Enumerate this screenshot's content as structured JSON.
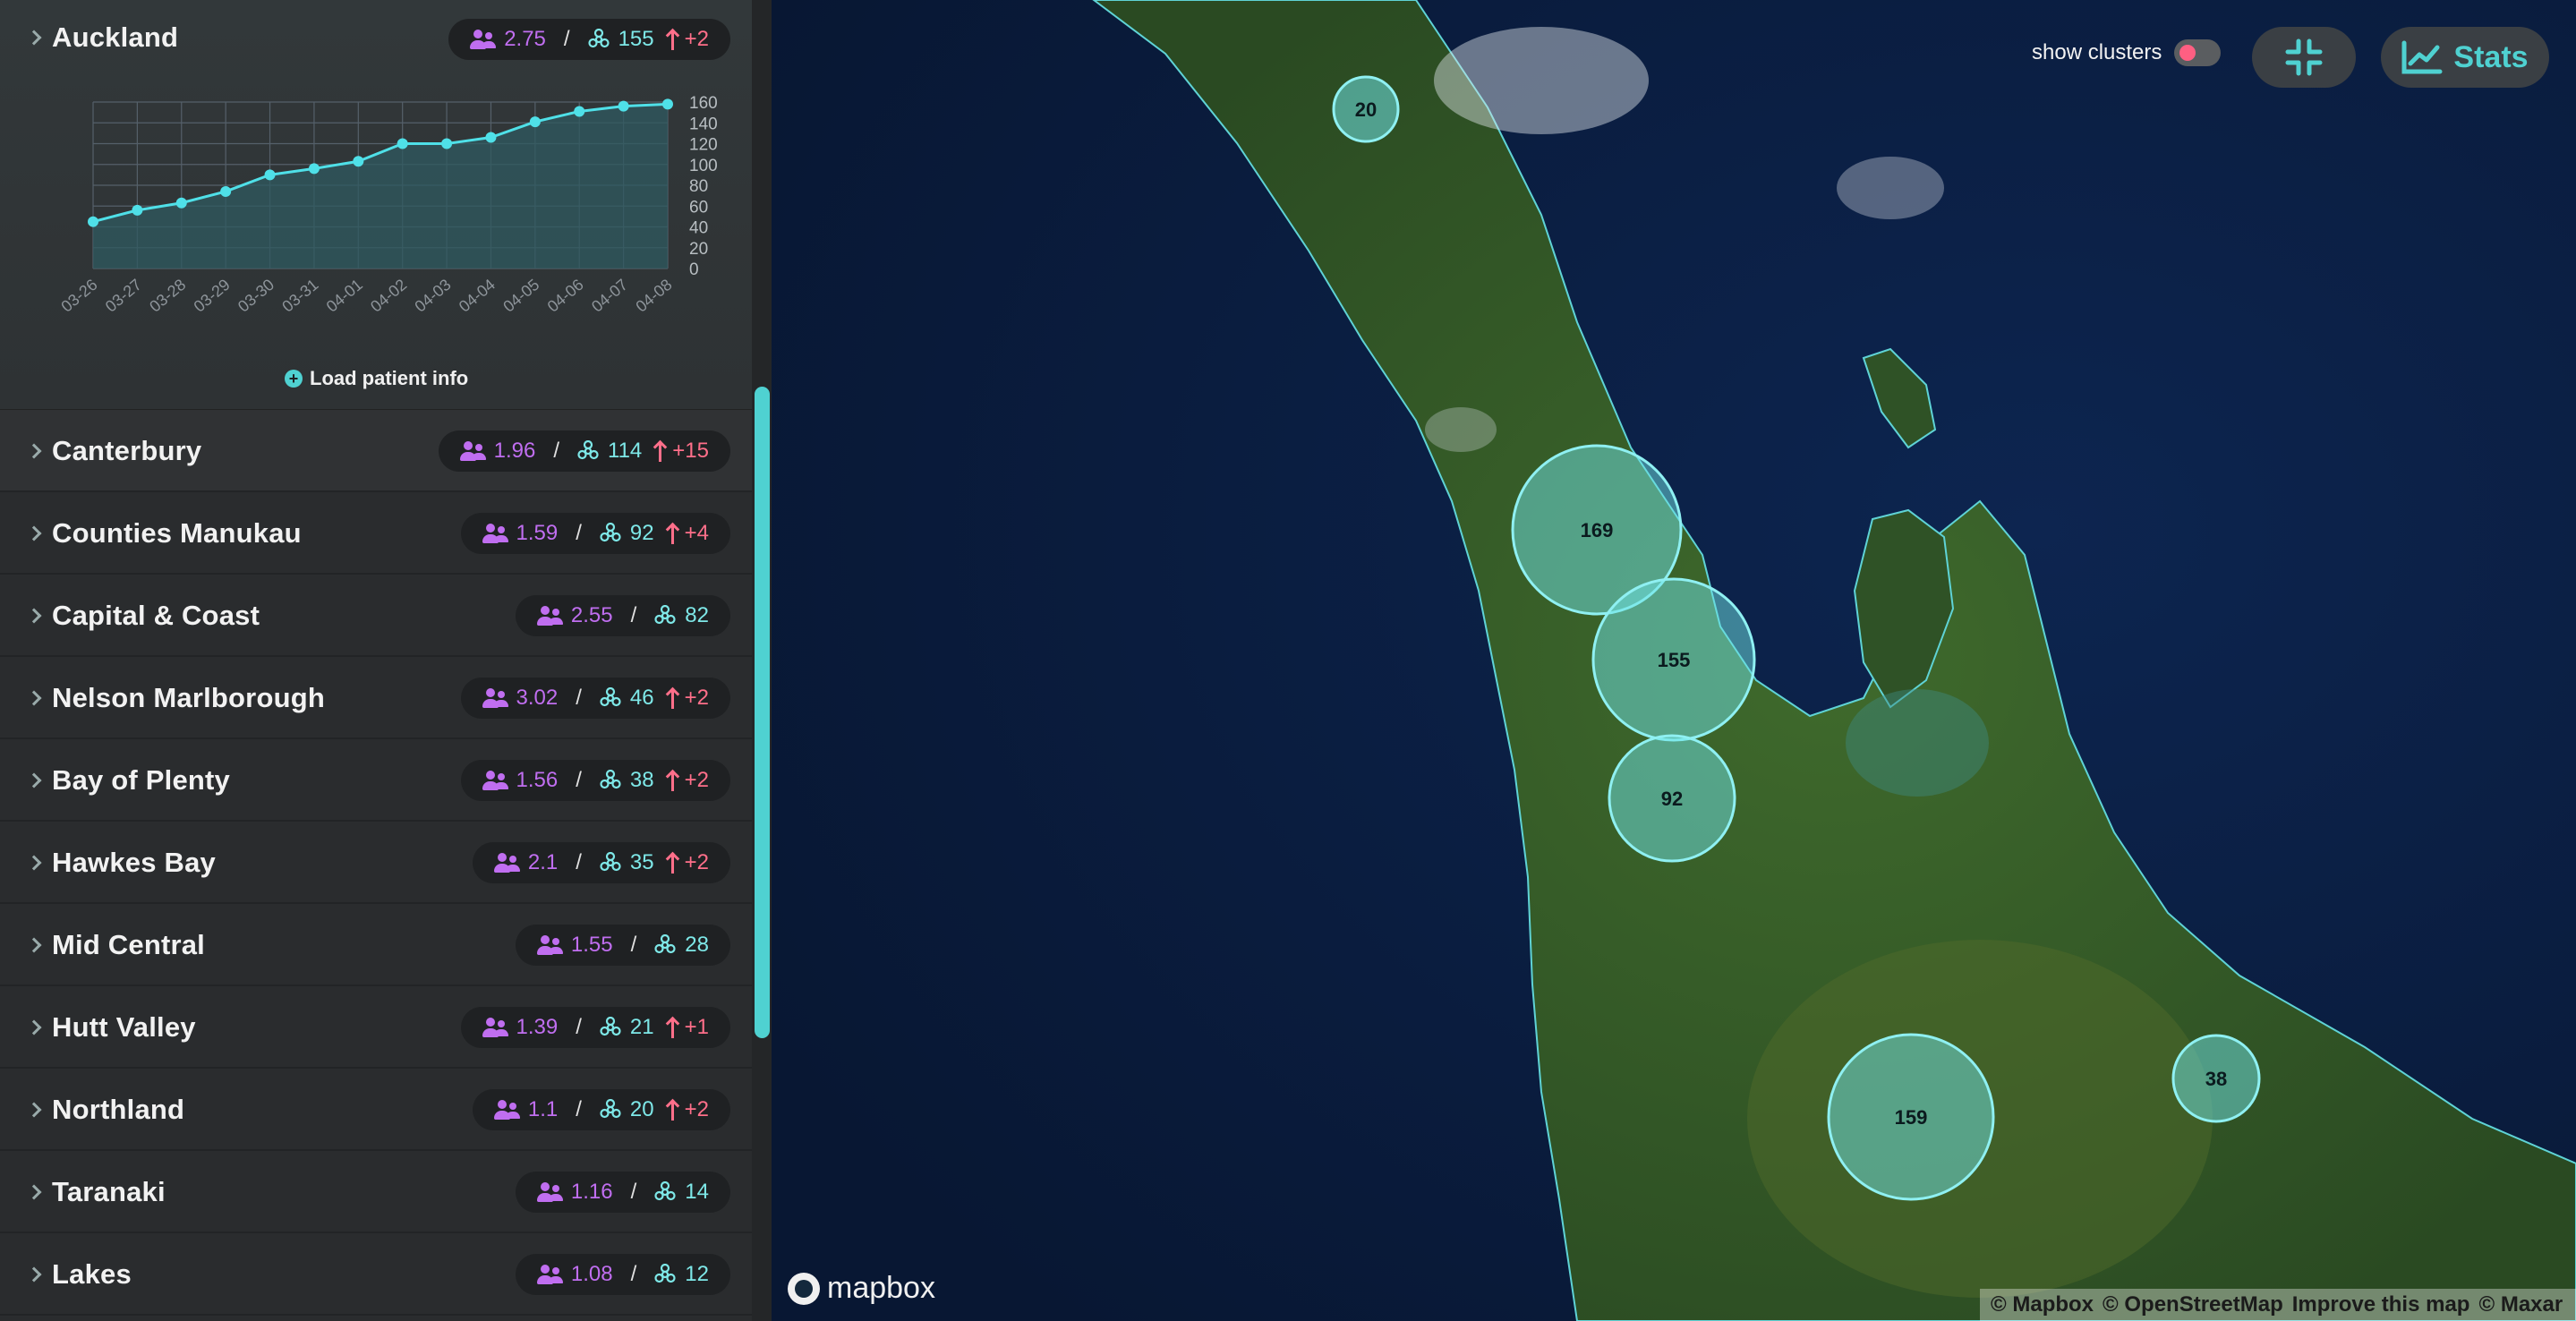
{
  "expanded": {
    "name": "Auckland",
    "per_thousand": "2.75",
    "cases": "155",
    "increase": "+2",
    "load_patient_info": "Load patient info"
  },
  "chart_data": {
    "type": "line",
    "categories": [
      "03-26",
      "03-27",
      "03-28",
      "03-29",
      "03-30",
      "03-31",
      "04-01",
      "04-02",
      "04-03",
      "04-04",
      "04-05",
      "04-06",
      "04-07",
      "04-08"
    ],
    "values": [
      45,
      56,
      63,
      74,
      90,
      96,
      103,
      120,
      120,
      126,
      141,
      151,
      156,
      158
    ],
    "ylim": [
      0,
      160
    ],
    "yticks": [
      0,
      20,
      40,
      60,
      80,
      100,
      120,
      140,
      160
    ],
    "grid": true,
    "colors": {
      "line": "#4fe0e8",
      "fill": "#2f5a60"
    }
  },
  "regions": [
    {
      "name": "Canterbury",
      "per_thousand": "1.96",
      "cases": "114",
      "increase": "+15"
    },
    {
      "name": "Counties Manukau",
      "per_thousand": "1.59",
      "cases": "92",
      "increase": "+4"
    },
    {
      "name": "Capital & Coast",
      "per_thousand": "2.55",
      "cases": "82",
      "increase": ""
    },
    {
      "name": "Nelson Marlborough",
      "per_thousand": "3.02",
      "cases": "46",
      "increase": "+2"
    },
    {
      "name": "Bay of Plenty",
      "per_thousand": "1.56",
      "cases": "38",
      "increase": "+2"
    },
    {
      "name": "Hawkes Bay",
      "per_thousand": "2.1",
      "cases": "35",
      "increase": "+2"
    },
    {
      "name": "Mid Central",
      "per_thousand": "1.55",
      "cases": "28",
      "increase": ""
    },
    {
      "name": "Hutt Valley",
      "per_thousand": "1.39",
      "cases": "21",
      "increase": "+1"
    },
    {
      "name": "Northland",
      "per_thousand": "1.1",
      "cases": "20",
      "increase": "+2"
    },
    {
      "name": "Taranaki",
      "per_thousand": "1.16",
      "cases": "14",
      "increase": ""
    },
    {
      "name": "Lakes",
      "per_thousand": "1.08",
      "cases": "12",
      "increase": ""
    }
  ],
  "map": {
    "clusters": [
      "20",
      "169",
      "155",
      "92",
      "159",
      "38"
    ],
    "show_clusters_label": "show clusters",
    "stats_label": "Stats",
    "logo_text": "mapbox",
    "attribution": [
      "© Mapbox",
      "© OpenStreetMap",
      "Improve this map",
      "© Maxar"
    ]
  },
  "icons": {
    "per_thousand": "people-icon",
    "cases": "biohazard-icon",
    "increase": "arrow-up-icon",
    "collapse": "collapse-icon",
    "stats": "chart-line-icon"
  },
  "colors": {
    "accent": "#4fd1d1",
    "per_thousand": "#c06ef0",
    "cases": "#7ee8e8",
    "increase": "#ff6f8a",
    "toggle_knob": "#ff5f82"
  }
}
